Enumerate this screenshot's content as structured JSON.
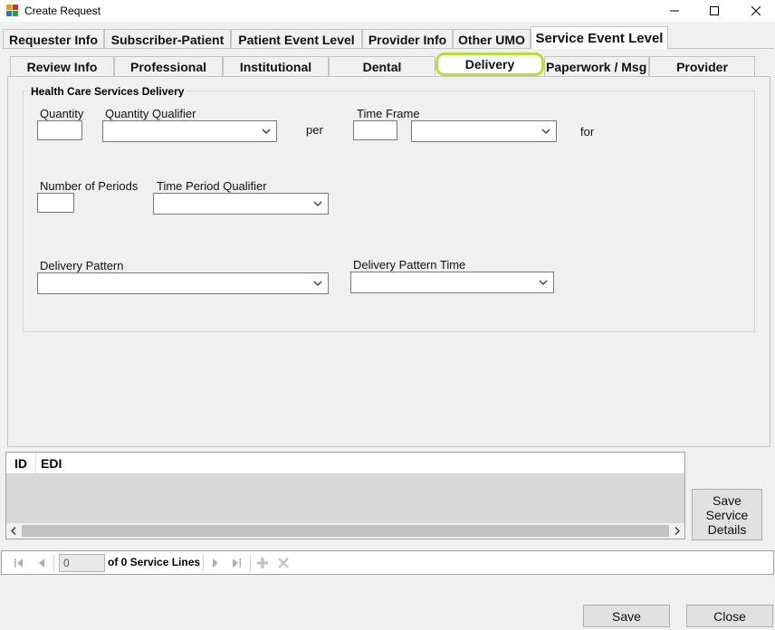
{
  "window": {
    "title": "Create Request"
  },
  "main_tabs": [
    "Requester Info",
    "Subscriber-Patient",
    "Patient Event Level",
    "Provider Info",
    "Other UMO",
    "Service Event Level"
  ],
  "sub_tabs": [
    "Review Info",
    "Professional",
    "Institutional",
    "Dental",
    "Delivery",
    "Paperwork / Msg",
    "Provider"
  ],
  "active_main_tab": "Service Event Level",
  "active_sub_tab": "Delivery",
  "highlight_color": "#b3e03c",
  "delivery": {
    "group_title": "Health Care Services Delivery",
    "quantity_label": "Quantity",
    "quantity_value": "",
    "quantity_qualifier_label": "Quantity Qualifier",
    "quantity_qualifier_value": "",
    "per_label": "per",
    "time_frame_label": "Time Frame",
    "time_frame_value": "",
    "time_frame_unit_value": "",
    "for_label": "for",
    "number_of_periods_label": "Number of Periods",
    "number_of_periods_value": "",
    "time_period_qualifier_label": "Time Period Qualifier",
    "time_period_qualifier_value": "",
    "delivery_pattern_label": "Delivery Pattern",
    "delivery_pattern_value": "",
    "delivery_pattern_time_label": "Delivery Pattern Time",
    "delivery_pattern_time_value": ""
  },
  "grid": {
    "columns": [
      "ID",
      "EDI"
    ],
    "rows": []
  },
  "save_service_details_label": "Save\nService\nDetails",
  "navigator": {
    "position_value": "0",
    "count_text": "of 0 Service Lines"
  },
  "footer": {
    "save_label": "Save",
    "close_label": "Close"
  }
}
